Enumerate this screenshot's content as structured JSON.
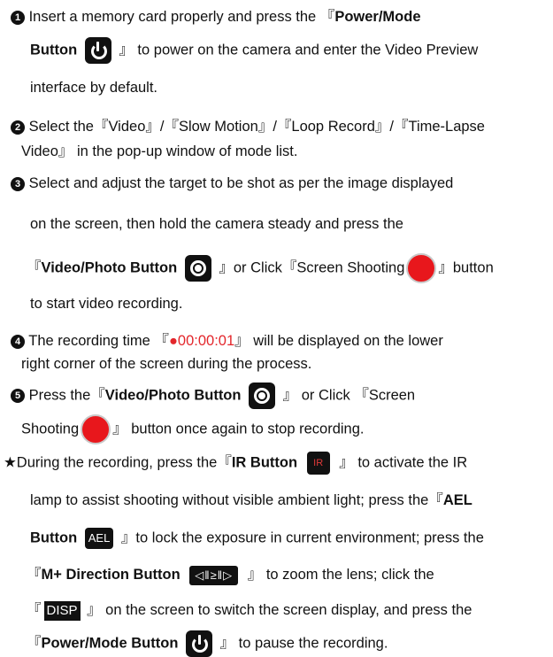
{
  "step1": {
    "num": "1",
    "a": " Insert a memory card properly and press the 『",
    "btn": "Power/Mode",
    "btn2": "Button",
    "b": " 』 to power on the camera and enter the Video Preview",
    "c": "interface by default."
  },
  "step2": {
    "num": "2",
    "a": " Select the『Video』/『Slow Motion』/『Loop Record』/『Time-Lapse",
    "b": "Video』 in the pop-up window of mode list."
  },
  "step3": {
    "num": "3",
    "a": " Select and adjust the target to be shot as per the image displayed",
    "b": "on the screen, then hold the camera steady and press the",
    "btn_open": "『",
    "btn": "Video/Photo Button",
    "c": " 』or Click『Screen Shooting",
    "d": "』button",
    "e": "to start video recording."
  },
  "step4": {
    "num": "4",
    "a": " The recording time 『",
    "time": "●00:00:01",
    "b": "』 will be displayed on the lower",
    "c": "right corner of the screen during the process."
  },
  "step5": {
    "num": "5",
    "a": " Press the『",
    "btn": "Video/Photo Button",
    "b": " 』 or Click 『Screen",
    "c": "Shooting",
    "d": "』 button once again to stop recording."
  },
  "note": {
    "a": "★During the recording, press the『",
    "ir_btn": "IR Button",
    "b": " 』 to activate the IR",
    "c": "lamp to assist shooting without visible ambient light; press the『",
    "ael1": "AEL",
    "ael2": "Button",
    "d": " 』to lock the exposure in current environment; press the",
    "m_open": "『",
    "m_btn": "M+ Direction Button",
    "e": " 』 to zoom the lens; click the",
    "f_open": "『",
    "f": " 』 on the screen to switch the screen display, and press the",
    "p_open": "『",
    "p_btn": "Power/Mode Button",
    "g": " 』 to pause the recording."
  },
  "icons": {
    "ir_label": "IR",
    "ael_label": "AEL",
    "mdir_label": "◁‖≥‖▷",
    "disp_label": "DISP"
  },
  "colors": {
    "accent_red": "#e3262b"
  }
}
